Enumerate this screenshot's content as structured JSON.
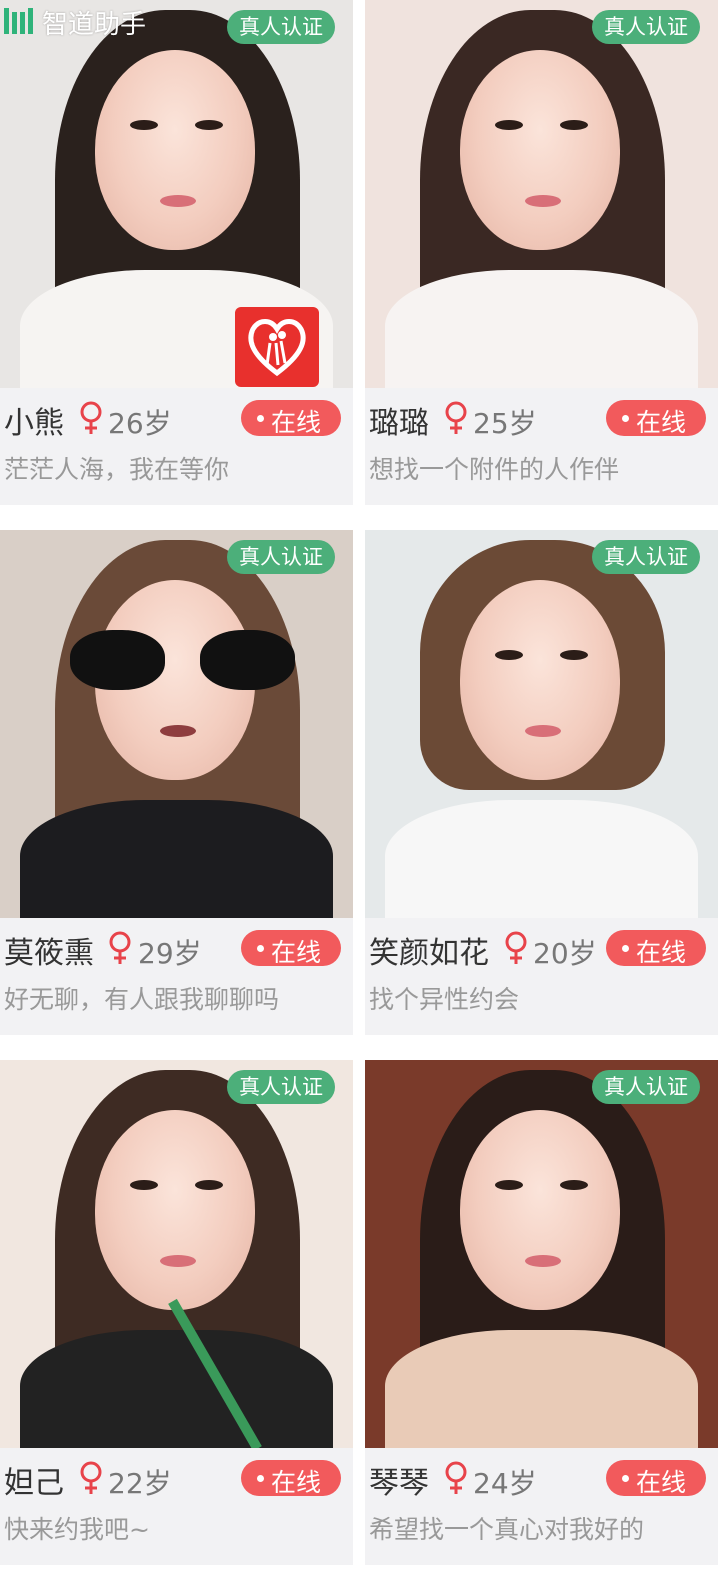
{
  "watermark": {
    "text": "智道助手",
    "icon": "brand-logo-icon"
  },
  "profiles": [
    {
      "name": "小熊",
      "gender_icon": "female-icon",
      "age": "26岁",
      "verified": "真人认证",
      "status": "在线",
      "bio": "茫茫人海，我在等你",
      "photo_tones": [
        "#e8e6e4",
        "#2a211d",
        "#f6f4f2"
      ],
      "has_app_logo": true
    },
    {
      "name": "璐璐",
      "gender_icon": "female-icon",
      "age": "25岁",
      "verified": "真人认证",
      "status": "在线",
      "bio": "想找一个附件的人作伴",
      "photo_tones": [
        "#f0e3de",
        "#3a2823",
        "#f7f3f2"
      ],
      "has_app_logo": false
    },
    {
      "name": "莫筱熏",
      "gender_icon": "female-icon",
      "age": "29岁",
      "verified": "真人认证",
      "status": "在线",
      "bio": "好无聊，有人跟我聊聊吗",
      "photo_tones": [
        "#d9cfc7",
        "#6a4a38",
        "#1c1c1f"
      ],
      "has_app_logo": false
    },
    {
      "name": "笑颜如花",
      "gender_icon": "female-icon",
      "age": "20岁",
      "verified": "真人认证",
      "status": "在线",
      "bio": "找个异性约会",
      "photo_tones": [
        "#e5e9ea",
        "#6b4a36",
        "#f7f7f7"
      ],
      "has_app_logo": false
    },
    {
      "name": "妲己",
      "gender_icon": "female-icon",
      "age": "22岁",
      "verified": "真人认证",
      "status": "在线",
      "bio": "快来约我吧~",
      "photo_tones": [
        "#f1e7e0",
        "#3e2b23",
        "#222222"
      ],
      "has_app_logo": false
    },
    {
      "name": "琴琴",
      "gender_icon": "female-icon",
      "age": "24岁",
      "verified": "真人认证",
      "status": "在线",
      "bio": "希望找一个真心对我好的",
      "photo_tones": [
        "#7a3a2a",
        "#2a1c18",
        "#e9cbb7"
      ],
      "has_app_logo": false
    }
  ],
  "colors": {
    "verified_bg": "#4caf7a",
    "online_bg": "#f25a5c",
    "female_icon": "#e8434a",
    "app_logo_bg": "#e8302d"
  }
}
